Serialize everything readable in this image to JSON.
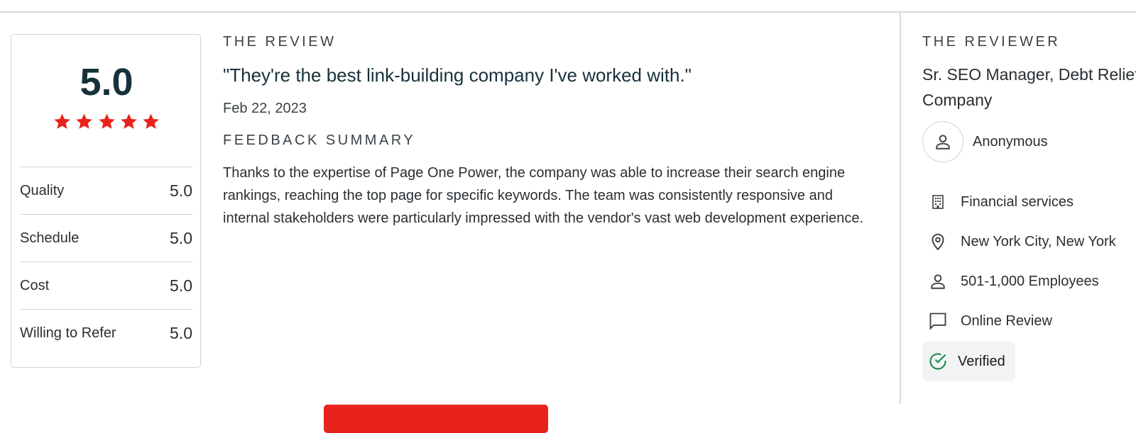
{
  "score_card": {
    "overall": "5.0",
    "stars": 5,
    "star_color": "#e8231b",
    "ratings": [
      {
        "label": "Quality",
        "value": "5.0"
      },
      {
        "label": "Schedule",
        "value": "5.0"
      },
      {
        "label": "Cost",
        "value": "5.0"
      },
      {
        "label": "Willing to Refer",
        "value": "5.0"
      }
    ]
  },
  "review": {
    "heading": "THE REVIEW",
    "quote": "\"They're the best link-building company I've worked with.\"",
    "date": "Feb 22, 2023",
    "summary_heading": "FEEDBACK SUMMARY",
    "summary": "Thanks to the expertise of Page One Power, the company was able to increase their search engine rankings, reaching the top page for specific keywords. The team was consistently responsive and internal stakeholders were particularly impressed with the vendor's vast web development experience."
  },
  "reviewer": {
    "heading": "THE REVIEWER",
    "position_line1": "Sr. SEO Manager, Debt Relief",
    "position_line2": "Company",
    "name": "Anonymous",
    "facts": [
      {
        "icon": "building-icon",
        "text": "Financial services"
      },
      {
        "icon": "location-pin-icon",
        "text": "New York City, New York"
      },
      {
        "icon": "person-icon",
        "text": "501-1,000 Employees"
      },
      {
        "icon": "chat-bubble-icon",
        "text": "Online Review"
      }
    ],
    "verified_label": "Verified",
    "verified_color": "#1e8a4c"
  },
  "accent_color": "#e8231b"
}
